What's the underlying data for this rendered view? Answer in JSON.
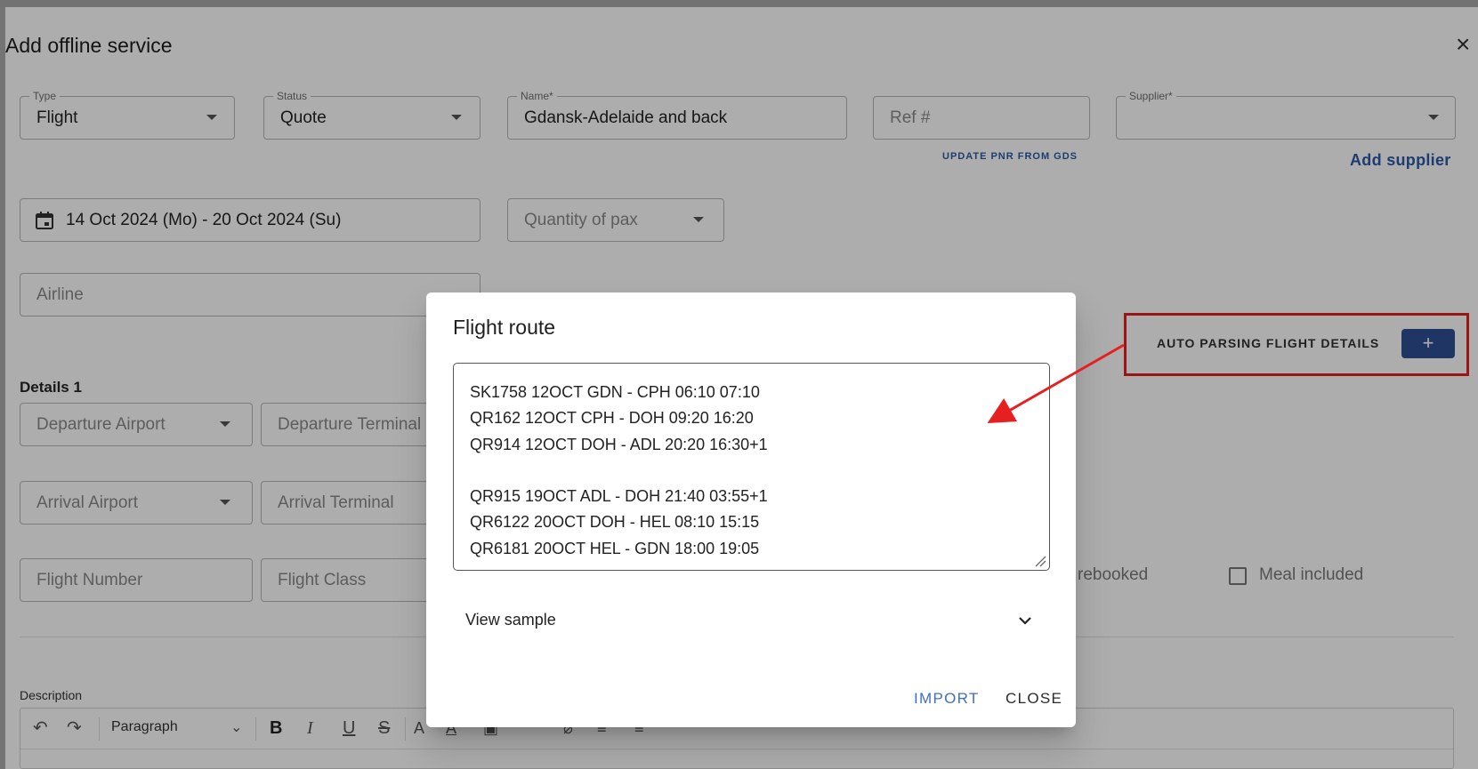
{
  "page": {
    "title": "Add offline service",
    "close_icon": "×",
    "type": {
      "label": "Type",
      "value": "Flight"
    },
    "status": {
      "label": "Status",
      "value": "Quote"
    },
    "name": {
      "label": "Name*",
      "value": "Gdansk-Adelaide and back"
    },
    "ref": {
      "placeholder": "Ref #"
    },
    "supplier": {
      "label": "Supplier*",
      "value": ""
    },
    "update_pnr": "UPDATE PNR FROM GDS",
    "add_supplier": "Add supplier",
    "date_range": "14 Oct 2024 (Mo) -  20 Oct 2024 (Su)",
    "quantity_pax": {
      "placeholder": "Quantity of pax"
    },
    "airline": {
      "placeholder": "Airline"
    },
    "auto_parsing": {
      "label": "AUTO PARSING FLIGHT DETAILS",
      "button": "+"
    },
    "details_title": "Details 1",
    "departure_airport": {
      "placeholder": "Departure Airport"
    },
    "departure_terminal": {
      "placeholder": "Departure Terminal"
    },
    "arrival_airport": {
      "placeholder": "Arrival Airport"
    },
    "arrival_terminal": {
      "placeholder": "Arrival Terminal"
    },
    "flight_number": {
      "placeholder": "Flight Number"
    },
    "flight_class": {
      "placeholder": "Flight Class"
    },
    "prebooked_label": "rebooked",
    "meal_included_label": "Meal included",
    "description_label": "Description",
    "editor": {
      "paragraph_select": "Paragraph",
      "bold": "B",
      "italic": "I",
      "underline": "U",
      "strike": "S"
    }
  },
  "dialog": {
    "title": "Flight route",
    "route_text": "SK1758 12OCT GDN - CPH 06:10 07:10\nQR162 12OCT CPH - DOH 09:20 16:20\nQR914 12OCT DOH - ADL 20:20 16:30+1\n\nQR915 19OCT ADL - DOH 21:40 03:55+1\nQR6122 20OCT DOH - HEL 08:10 15:15\nQR6181 20OCT HEL - GDN 18:00 19:05",
    "view_sample": "View sample",
    "import_button": "IMPORT",
    "close_button": "CLOSE"
  },
  "colors": {
    "accent": "#2e4f93",
    "link": "#2c5aa6",
    "annotation_red": "#e62020"
  }
}
